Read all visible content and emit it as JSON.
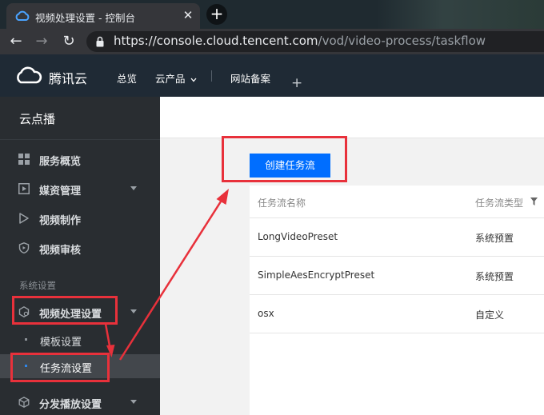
{
  "browser": {
    "tab_title": "视频处理设置 - 控制台",
    "tab_close": "✕",
    "new_tab": "+",
    "back": "←",
    "forward": "→",
    "reload": "↻",
    "url_host": "https://console.cloud.tencent.com",
    "url_path": "/vod/video-process/taskflow"
  },
  "topnav": {
    "brand": "腾讯云",
    "items": [
      "总览",
      "云产品",
      "网站备案"
    ],
    "plus": "+"
  },
  "sidebar": {
    "title": "云点播",
    "items": [
      {
        "label": "服务概览",
        "icon": "grid-icon"
      },
      {
        "label": "媒资管理",
        "icon": "media-play-icon",
        "expandable": true
      },
      {
        "label": "视频制作",
        "icon": "play-icon"
      },
      {
        "label": "视频审核",
        "icon": "shield-icon"
      }
    ],
    "section_title": "系统设置",
    "settings_item": {
      "label": "视频处理设置",
      "icon": "gear-video-icon",
      "expandable": true
    },
    "sub_items": [
      {
        "label": "模板设置",
        "active": false
      },
      {
        "label": "任务流设置",
        "active": true
      }
    ],
    "last_item": {
      "label": "分发播放设置",
      "icon": "cube-icon",
      "expandable": true
    }
  },
  "main": {
    "create_button": "创建任务流",
    "table": {
      "columns": [
        "任务流名称",
        "任务流类型"
      ],
      "rows": [
        {
          "name": "LongVideoPreset",
          "type": "系统预置"
        },
        {
          "name": "SimpleAesEncryptPreset",
          "type": "系统预置"
        },
        {
          "name": "osx",
          "type": "自定义"
        }
      ]
    }
  },
  "colors": {
    "accent": "#006eff",
    "annotation": "#e8313b",
    "sidebar_bg": "#292d31",
    "topnav_bg": "#1f2a35"
  }
}
